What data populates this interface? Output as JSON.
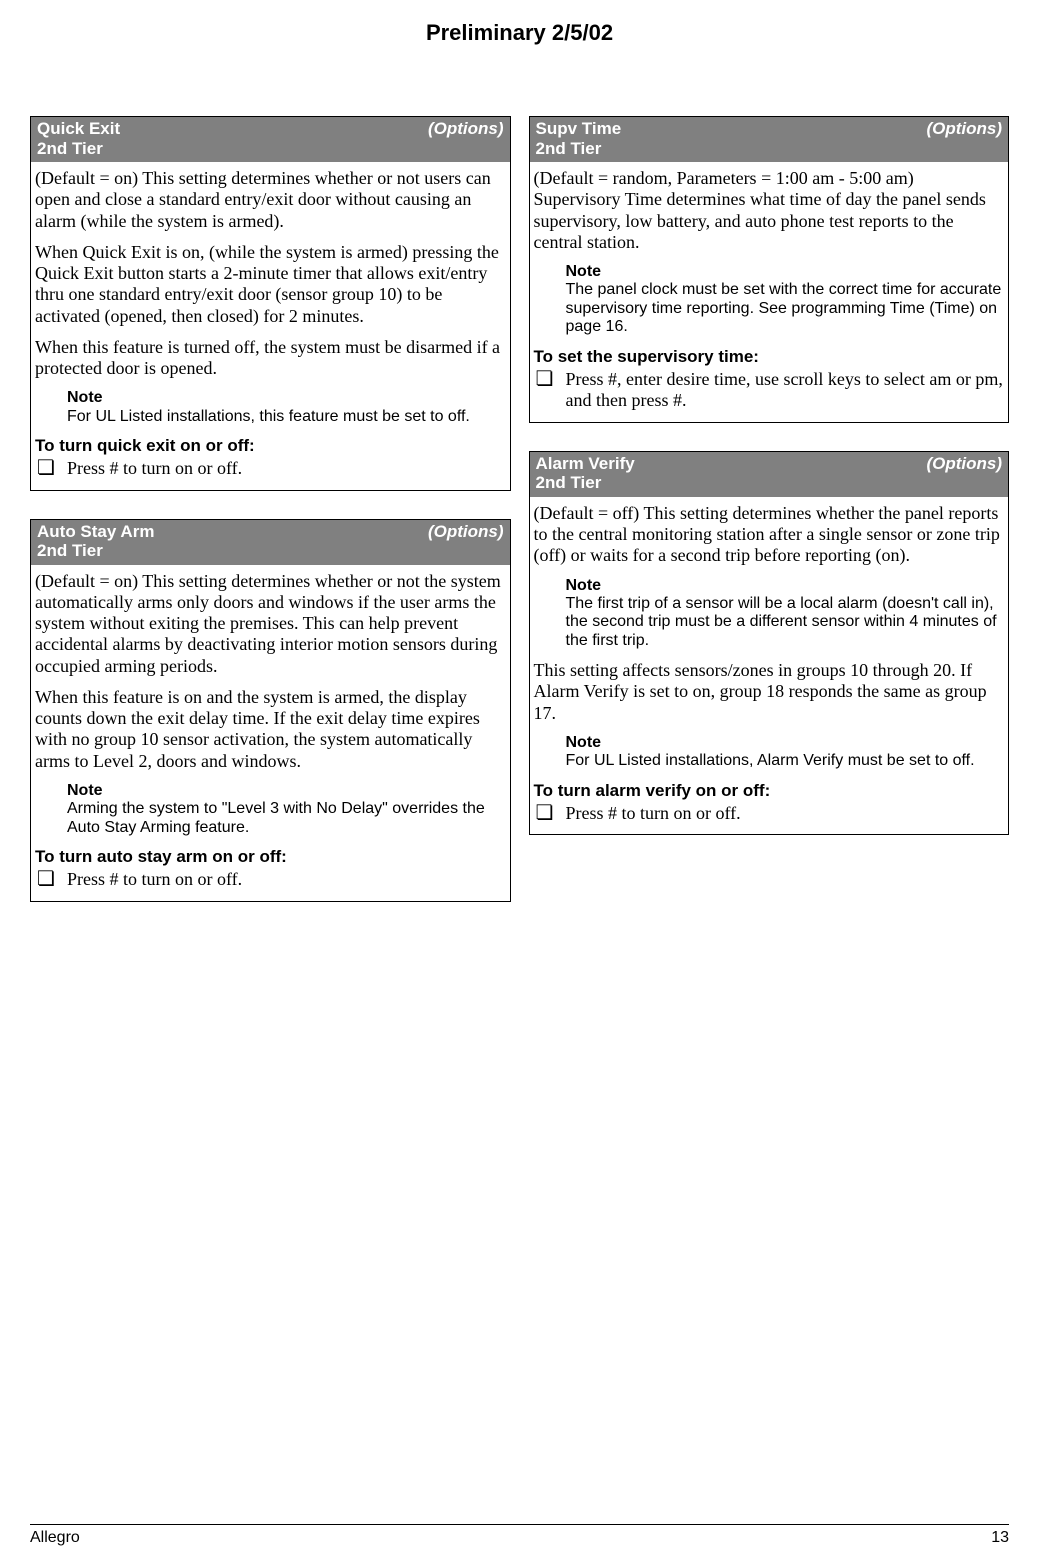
{
  "header": {
    "preliminary": "Preliminary 2/5/02"
  },
  "footer": {
    "left": "Allegro",
    "right": "13"
  },
  "common": {
    "options": "(Options)",
    "tier": "2nd Tier",
    "note": "Note",
    "checkbox": "❏"
  },
  "boxes": {
    "quickExit": {
      "title": "Quick Exit",
      "p1": "(Default = on) This setting determines whether or not users can open and close a standard entry/exit door without causing an alarm (while the system is armed).",
      "p2": "When Quick Exit is on, (while the system is armed) pressing the Quick Exit button starts a 2-minute timer that allows exit/entry thru one standard entry/exit door (sensor group 10) to be activated (opened, then closed) for 2 minutes.",
      "p3": "When this feature is turned off, the system must be disarmed if a protected door is opened.",
      "note1": "For UL Listed installations, this feature must be set to off.",
      "actionHeading": "To turn quick exit on or off:",
      "actionText": "Press # to turn on or off."
    },
    "autoStay": {
      "title": "Auto Stay Arm",
      "p1": "(Default = on) This setting determines whether or not the system automatically arms only doors and windows if the user arms the system without exiting the premises. This can help prevent accidental alarms by deactivating interior motion sensors during occupied arming periods.",
      "p2": "When this feature is on and the system is armed, the display counts down the exit delay time. If the exit delay time expires with no group 10 sensor activation, the system automatically arms to Level 2, doors and windows.",
      "note1": "Arming the system to \"Level 3 with No Delay\" overrides the Auto Stay Arming feature.",
      "actionHeading": "To turn auto stay arm on or off:",
      "actionText": "Press # to turn on or off."
    },
    "supvTime": {
      "title": "Supv Time",
      "p1": "(Default = random, Parameters = 1:00 am - 5:00 am) Supervisory Time determines what time of day the panel sends supervisory, low battery, and auto phone test reports to the central station.",
      "note1": "The panel clock must be set with the correct time for accurate supervisory time reporting. See programming Time (Time) on page 16.",
      "actionHeading": "To set the supervisory time:",
      "actionText": "Press #, enter desire time, use scroll keys to select am or pm, and then press #."
    },
    "alarmVerify": {
      "title": "Alarm Verify",
      "p1": "(Default = off) This setting determines whether the panel reports to the central monitoring station after a single sensor or zone trip (off) or waits for a second trip before reporting (on).",
      "note1": "The first trip of a sensor will be a local alarm (doesn't call in), the second trip must be a different sensor within 4 minutes of the first trip.",
      "p2": "This setting affects sensors/zones in groups 10 through 20. If Alarm Verify is set to on, group 18 responds the same as group 17.",
      "note2": "For UL Listed installations, Alarm Verify must be set to off.",
      "actionHeading": "To turn alarm verify on or off:",
      "actionText": "Press # to turn on or off."
    }
  }
}
